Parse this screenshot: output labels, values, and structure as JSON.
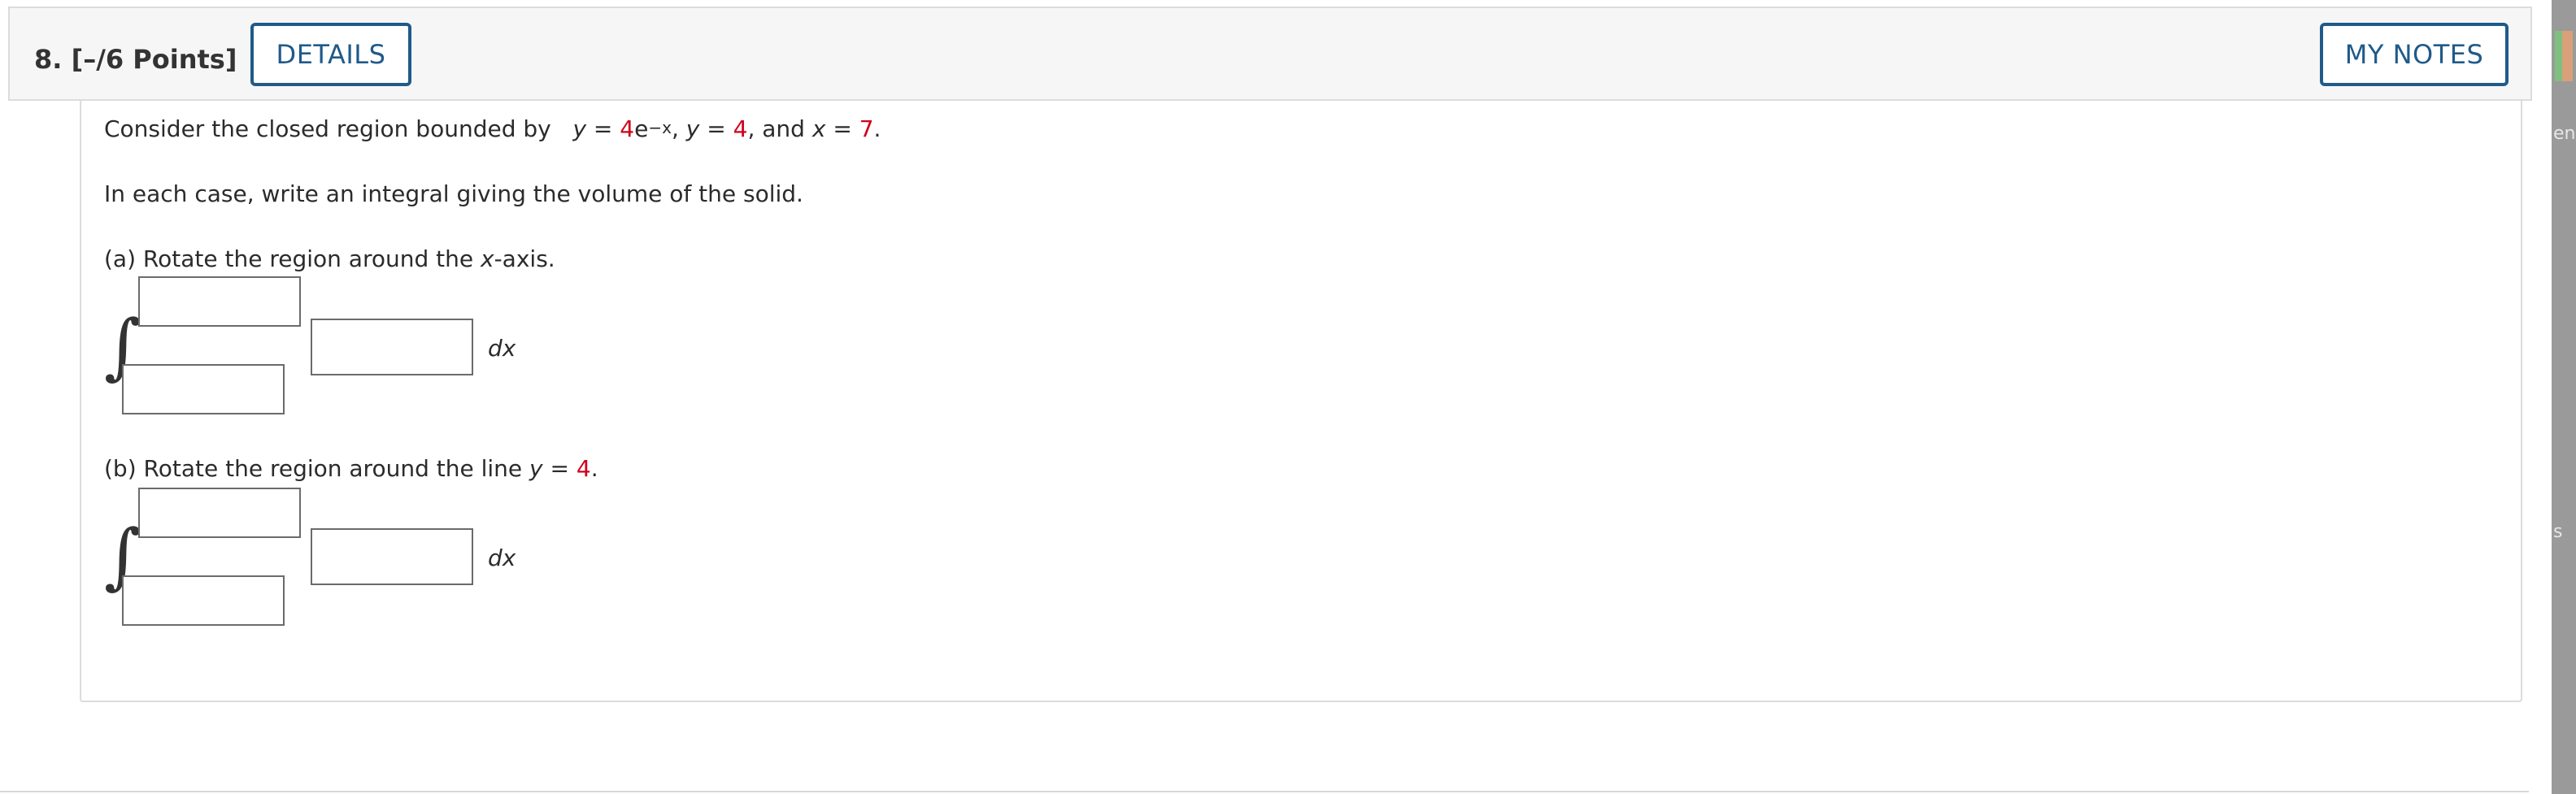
{
  "question": {
    "number_label": "8.",
    "points_label": "[–/6 Points]",
    "details_label": "DETAILS",
    "notes_label": "MY NOTES"
  },
  "problem": {
    "intro_prefix": "Consider the closed region bounded by",
    "y1_var": "y",
    "eq": "=",
    "y1_coef": "4",
    "y1_base": "e",
    "y1_exp": "−x",
    "sep1": ",",
    "y2_var": "y",
    "y2_val": "4",
    "sep2": ", and",
    "x_var": "x",
    "x_val": "7",
    "period": ".",
    "instruction": "In each case, write an integral giving the volume of the solid."
  },
  "part_a": {
    "label_prefix": "(a) Rotate the region around the",
    "axis": "x",
    "label_suffix": "-axis.",
    "differential": "dx",
    "upper_limit": "",
    "lower_limit": "",
    "integrand": ""
  },
  "part_b": {
    "label_prefix": "(b) Rotate the region around the line",
    "var": "y",
    "eq": "=",
    "value": "4",
    "period": ".",
    "differential": "dx",
    "upper_limit": "",
    "lower_limit": "",
    "integrand": ""
  },
  "side": {
    "text1": "en",
    "text2": "s"
  },
  "colors": {
    "accent_blue": "#1f5a8a",
    "given_value_red": "#d0021b"
  },
  "icons": {
    "integral": "∫"
  }
}
